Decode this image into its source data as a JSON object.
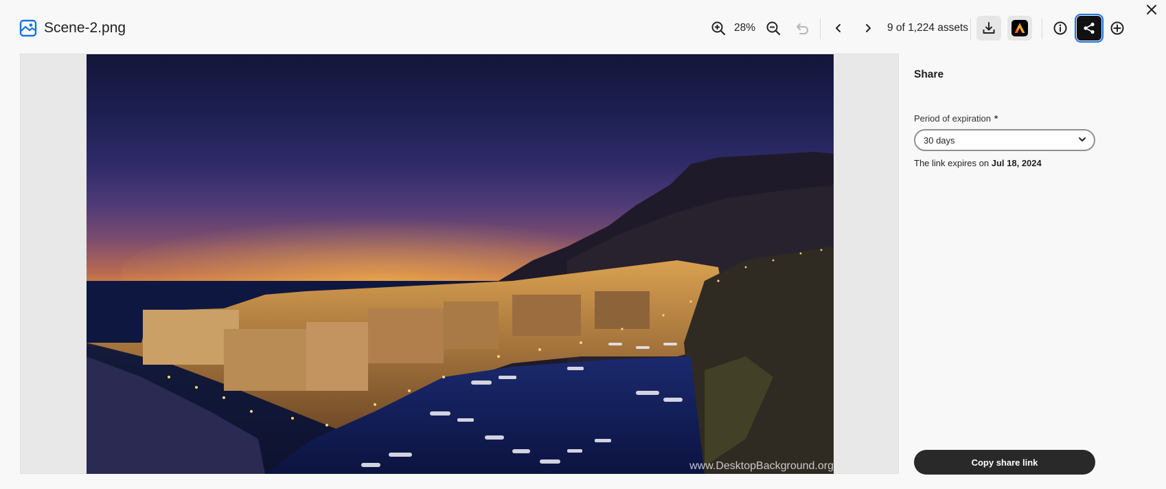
{
  "header": {
    "file_name": "Scene-2.png",
    "zoom_level": "28%",
    "asset_position": "9 of 1,224 assets"
  },
  "preview": {
    "watermark": "www.DesktopBackground.org"
  },
  "share_panel": {
    "title": "Share",
    "expiration_label": "Period of expiration",
    "required_marker": "*",
    "expiration_value": "30 days",
    "expiry_note_prefix": "The link expires on",
    "expiry_date": "Jul 18, 2024",
    "copy_button_label": "Copy share link"
  },
  "colors": {
    "accent_selected": "#1473e6",
    "primary_button": "#292929",
    "background": "#f8f8f8"
  }
}
